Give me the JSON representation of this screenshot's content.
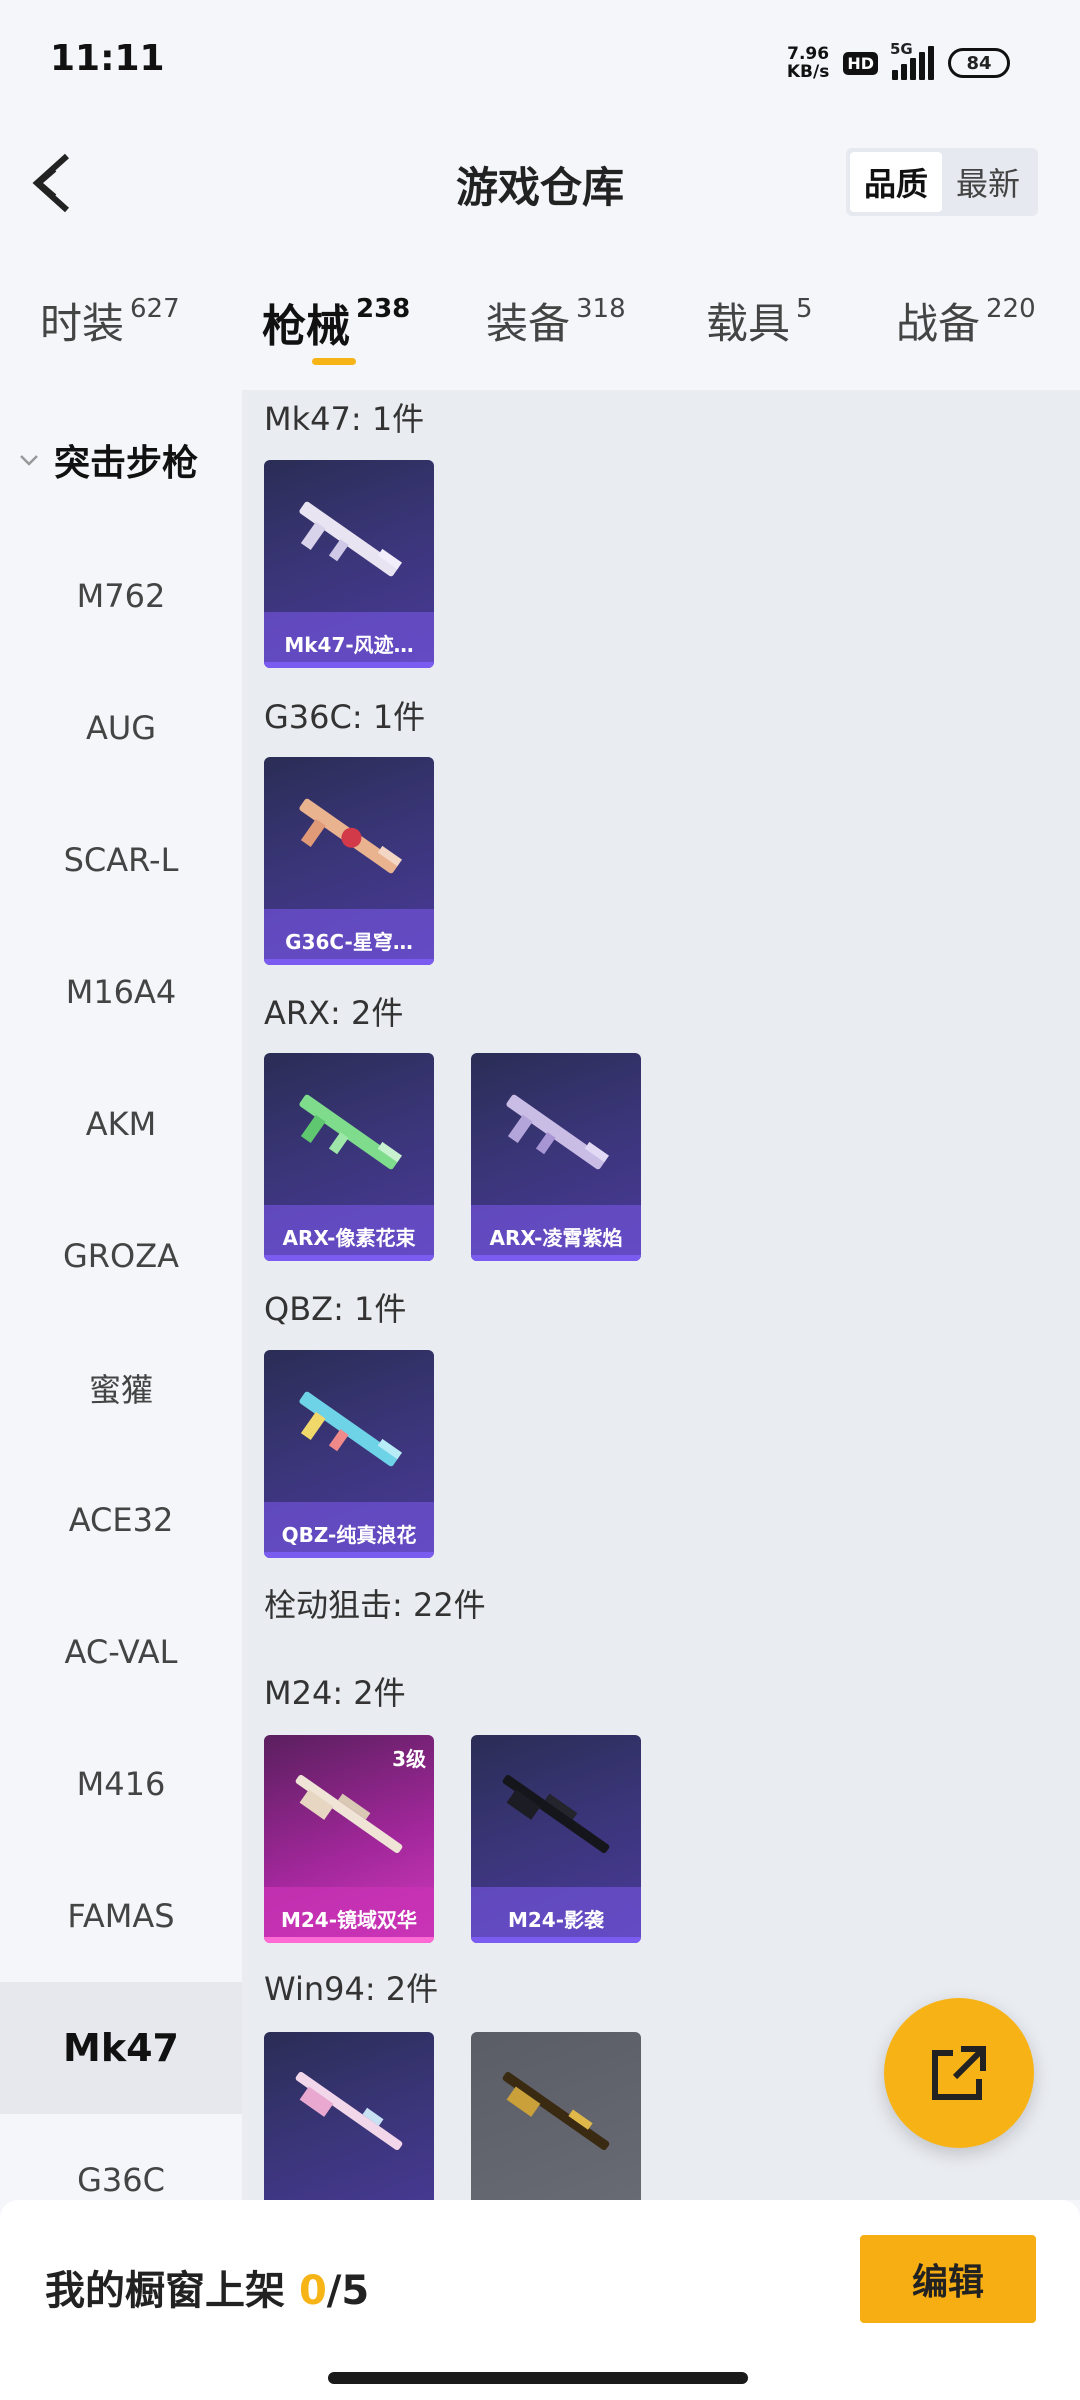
{
  "status": {
    "time": "11:11",
    "net_speed_value": "7.96",
    "net_speed_unit": "KB/s",
    "hd": "HD",
    "network": "5G",
    "battery": "84"
  },
  "header": {
    "title": "游戏仓库",
    "sort_quality": "品质",
    "sort_latest": "最新"
  },
  "tabs": [
    {
      "label": "时装",
      "count": "627"
    },
    {
      "label": "枪械",
      "count": "238"
    },
    {
      "label": "装备",
      "count": "318"
    },
    {
      "label": "载具",
      "count": "5"
    },
    {
      "label": "战备",
      "count": "220"
    }
  ],
  "sidebar": {
    "group": "突击步枪",
    "items": [
      "M762",
      "AUG",
      "SCAR-L",
      "M16A4",
      "AKM",
      "GROZA",
      "蜜獾",
      "ACE32",
      "AC-VAL",
      "M416",
      "FAMAS",
      "Mk47",
      "G36C"
    ]
  },
  "content": {
    "mk47_title": "Mk47: 1件",
    "mk47_card": "Mk47-风迹…",
    "g36c_title": "G36C: 1件",
    "g36c_card": "G36C-星穹…",
    "arx_title": "ARX: 2件",
    "arx_card1": "ARX-像素花束",
    "arx_card2": "ARX-凌霄紫焰",
    "qbz_title": "QBZ: 1件",
    "qbz_card": "QBZ-纯真浪花",
    "bolt_title": "栓动狙击: 22件",
    "m24_title": "M24: 2件",
    "m24_card1": "M24-镜域双华",
    "m24_card1_level": "3级",
    "m24_card2": "M24-影袭",
    "win94_title": "Win94: 2件"
  },
  "bottom": {
    "showcase_label": "我的橱窗上架",
    "showcase_current": "0",
    "showcase_total": "/5",
    "edit_label": "编辑"
  },
  "colors": {
    "accent": "#f6b417",
    "card_purple": "#3a3578",
    "card_pink": "#a1279a"
  }
}
